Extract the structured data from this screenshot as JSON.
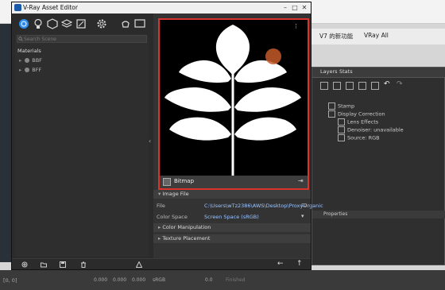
{
  "window": {
    "title": "V-Ray Asset Editor"
  },
  "search": {
    "placeholder": "Search Scene"
  },
  "materials": {
    "header": "Materials",
    "items": [
      {
        "name": "BBF"
      },
      {
        "name": "BFF"
      }
    ]
  },
  "preview": {
    "bar_label": "Bitmap"
  },
  "image_file": {
    "section_title": "Image File",
    "file_label": "File",
    "file_value": "C:\\Users\\wTz2386\\AWS\\Desktop\\ProxyOrganic",
    "colorspace_label": "Color Space",
    "colorspace_value": "Screen Space (sRGB)"
  },
  "sections": {
    "color_manipulation": "Color Manipulation",
    "texture_placement": "Texture Placement"
  },
  "background": {
    "tab_1": "V7 的新功能",
    "tab_2": "VRay All",
    "vfb_tab_layers": "Layers",
    "vfb_tab_stats": "Stats",
    "properties": "Properties",
    "layers": [
      "Stamp",
      "Display Correction",
      "Lens Effects",
      "Denoiser: unavailable",
      "Source: RGB"
    ],
    "bottom_coords": "[0, 0]",
    "bottom_vals": [
      "0.000",
      "0.000",
      "0.000"
    ],
    "bottom_srgb": "sRGB",
    "bottom_zero": "0.0",
    "bottom_finished": "Finished"
  }
}
